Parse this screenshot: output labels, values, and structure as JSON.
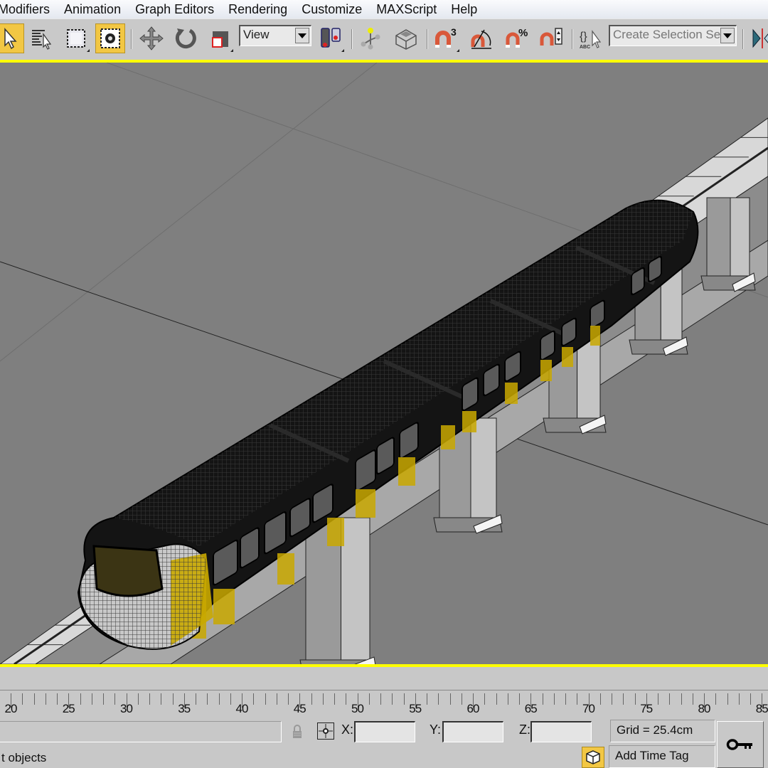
{
  "menubar": {
    "items": [
      "Modifiers",
      "Animation",
      "Graph Editors",
      "Rendering",
      "Customize",
      "MAXScript",
      "Help"
    ]
  },
  "toolbar": {
    "reference_coord_value": "View",
    "selection_set_placeholder": "Create Selection Set",
    "tools": [
      {
        "name": "select-object",
        "active": true
      },
      {
        "name": "select-by-name",
        "active": false
      },
      {
        "name": "rectangular-selection-region",
        "active": false
      },
      {
        "name": "window-crossing",
        "active": true
      },
      {
        "name": "select-and-move",
        "active": false
      },
      {
        "name": "select-and-rotate",
        "active": false
      },
      {
        "name": "select-and-scale",
        "active": false
      },
      {
        "name": "use-pivot-point-center",
        "active": false
      },
      {
        "name": "select-and-manipulate",
        "active": false
      },
      {
        "name": "keyboard-shortcut-override",
        "active": false
      },
      {
        "name": "snaps-toggle-3d",
        "active": false
      },
      {
        "name": "angle-snap-toggle",
        "active": false
      },
      {
        "name": "percent-snap-toggle",
        "active": false
      },
      {
        "name": "spinner-snap-toggle",
        "active": false
      },
      {
        "name": "edit-named-selection-sets",
        "active": false
      },
      {
        "name": "mirror",
        "active": false
      }
    ],
    "snap_label": "3",
    "percent_label": "%",
    "abc_label": "ABC"
  },
  "viewport": {
    "active_border_color": "#ffff00",
    "background_color": "#7f7f7f",
    "accent_yellow": "#c9a800"
  },
  "timeline": {
    "ticks": [
      "20",
      "25",
      "30",
      "35",
      "40",
      "45",
      "50",
      "55",
      "60",
      "65",
      "70",
      "75",
      "80",
      "85"
    ]
  },
  "status": {
    "prompt_text": "t objects",
    "x_label": "X:",
    "y_label": "Y:",
    "z_label": "Z:",
    "x_value": "",
    "y_value": "",
    "z_value": "",
    "grid_text": "Grid = 25.4cm",
    "time_tag_label": "Add Time Tag"
  }
}
